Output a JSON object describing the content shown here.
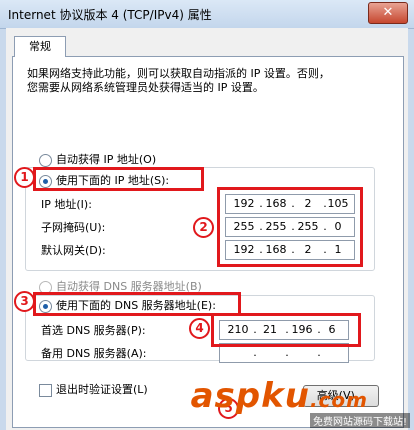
{
  "window": {
    "title": "Internet 协议版本 4 (TCP/IPv4) 属性",
    "close_label": "✕"
  },
  "tabs": [
    {
      "label": "常规"
    }
  ],
  "description": {
    "line1": "如果网络支持此功能，则可以获取自动指派的 IP 设置。否则，",
    "line2": "您需要从网络系统管理员处获得适当的 IP 设置。"
  },
  "ip_section": {
    "auto_label": "自动获得 IP 地址(O)",
    "manual_label": "使用下面的 IP 地址(S):",
    "selected": "manual",
    "fields": [
      {
        "label": "IP 地址(I):",
        "octets": [
          "192",
          "168",
          "2",
          "105"
        ]
      },
      {
        "label": "子网掩码(U):",
        "octets": [
          "255",
          "255",
          "255",
          "0"
        ]
      },
      {
        "label": "默认网关(D):",
        "octets": [
          "192",
          "168",
          "2",
          "1"
        ]
      }
    ]
  },
  "dns_section": {
    "auto_label": "自动获得 DNS 服务器地址(B)",
    "manual_label": "使用下面的 DNS 服务器地址(E):",
    "selected": "manual",
    "fields": [
      {
        "label": "首选 DNS 服务器(P):",
        "octets": [
          "210",
          "21",
          "196",
          "6"
        ]
      },
      {
        "label": "备用 DNS 服务器(A):",
        "octets": [
          "",
          "",
          "",
          ""
        ]
      }
    ]
  },
  "validate_checkbox": {
    "label": "退出时验证设置(L)",
    "checked": false
  },
  "advanced_button": {
    "label": "高级(V)..."
  },
  "annotations": {
    "c1": "1",
    "c2": "2",
    "c3": "3",
    "c4": "4",
    "c5": "5"
  },
  "watermark": {
    "brand_a": "asp",
    "brand_b": "ku",
    "brand_c": ".com",
    "tagline": "免费网站源码下载站!"
  },
  "colors": {
    "highlight": "#e1181c",
    "radio": "#1f5fa8"
  }
}
